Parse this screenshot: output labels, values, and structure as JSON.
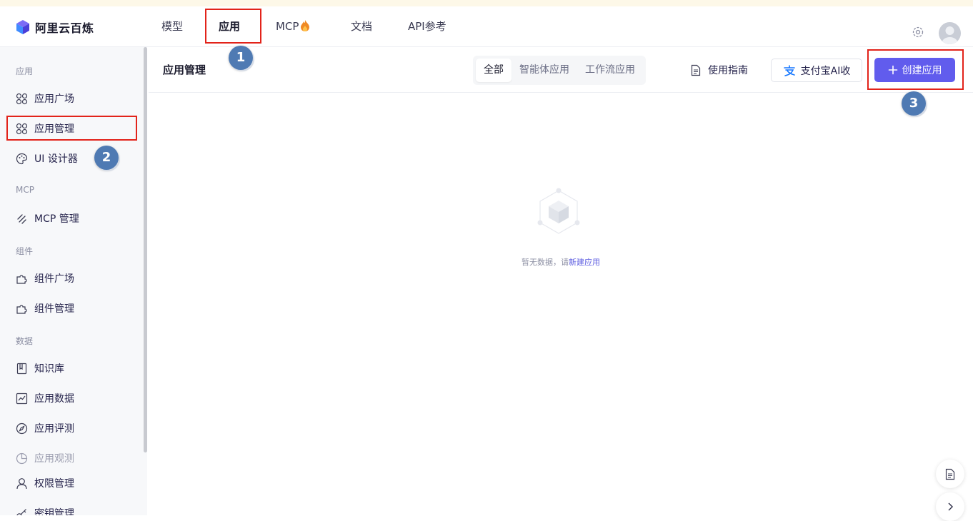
{
  "app": {
    "logo_text": "阿里云百炼"
  },
  "topnav": {
    "items": [
      {
        "label": "模型",
        "active": false
      },
      {
        "label": "应用",
        "active": true
      },
      {
        "label": "MCP",
        "active": false,
        "icon": "fire-icon"
      },
      {
        "label": "文档",
        "active": false
      },
      {
        "label": "API参考",
        "active": false
      }
    ]
  },
  "annotations": {
    "step1": "1",
    "step2": "2",
    "step3": "3",
    "highlight_color": "#e2231a"
  },
  "sidebar": {
    "sections": [
      {
        "title": "应用",
        "items": [
          {
            "label": "应用广场",
            "icon": "apps-icon"
          },
          {
            "label": "应用管理",
            "icon": "apps-icon",
            "highlighted": true
          },
          {
            "label": "UI 设计器",
            "icon": "palette-icon"
          }
        ]
      },
      {
        "title": "MCP",
        "items": [
          {
            "label": "MCP 管理",
            "icon": "mcp-icon"
          }
        ]
      },
      {
        "title": "组件",
        "items": [
          {
            "label": "组件广场",
            "icon": "puzzle-icon"
          },
          {
            "label": "组件管理",
            "icon": "puzzle-icon"
          }
        ]
      },
      {
        "title": "数据",
        "items": [
          {
            "label": "知识库",
            "icon": "book-icon"
          },
          {
            "label": "应用数据",
            "icon": "chart-icon"
          },
          {
            "label": "应用评测",
            "icon": "compass-icon"
          },
          {
            "label": "应用观测",
            "icon": "pie-icon",
            "muted": true
          },
          {
            "label": "权限管理",
            "icon": "user-icon"
          },
          {
            "label": "密钥管理",
            "icon": "key-icon"
          }
        ]
      }
    ]
  },
  "main": {
    "title": "应用管理",
    "filters": [
      "全部",
      "智能体应用",
      "工作流应用"
    ],
    "active_filter": "全部",
    "guide_label": "使用指南",
    "alipay_label": "支付宝AI收",
    "create_label": "创建应用",
    "empty_text": "暂无数据，请",
    "empty_link": "新建应用"
  },
  "colors": {
    "primary": "#615ced",
    "badge": "#4f7ab3"
  }
}
